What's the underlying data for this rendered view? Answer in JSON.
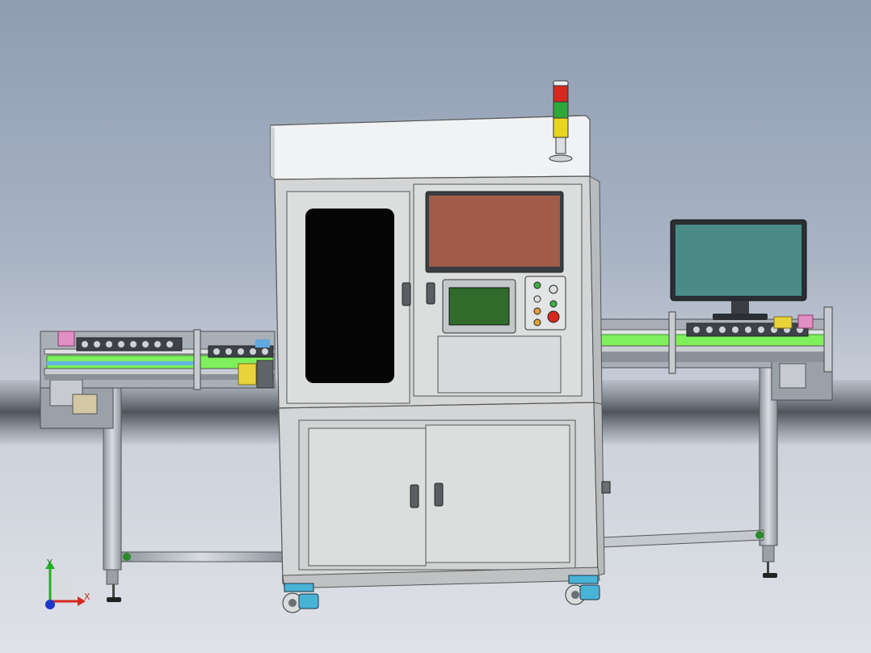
{
  "axes": {
    "x_label": "X",
    "y_label": "Y"
  },
  "colors": {
    "background_top": "#8f9db2",
    "background_bottom": "#dfe2e7",
    "cabinet": "#d4d5d6",
    "cabinet_top": "#f1f2f3",
    "upper_screen": "#a05c48",
    "hmi_screen": "#2f6b2a",
    "monitor_screen": "#4a8b87",
    "conveyor_belt": "#7ef05c",
    "light_red": "#d6281e",
    "light_yellow": "#e8d61c",
    "light_green": "#2fa83a"
  },
  "objects": [
    "conveyor-left",
    "conveyor-right",
    "machine-cabinet",
    "tower-light",
    "upper-display",
    "hmi-touch-panel",
    "control-button-panel",
    "desktop-monitor",
    "cabinet-door-left",
    "cabinet-door-right",
    "caster-wheel"
  ]
}
